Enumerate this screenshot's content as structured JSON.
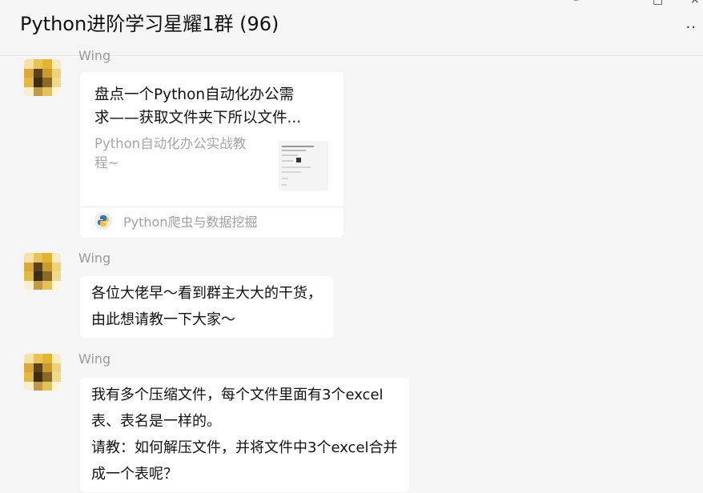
{
  "header": {
    "title": "Python进阶学习星耀1群 (96)",
    "minimize_glyph": "–",
    "maximize_glyph": "□",
    "close_glyph": "×",
    "more_glyph": "··"
  },
  "messages": [
    {
      "sender": "Wing",
      "type": "link-card",
      "card": {
        "title_lines": [
          "盘点一个Python自动化办公需",
          "求——获取文件夹下所以文件..."
        ],
        "desc_lines": [
          "Python自动化办公实战教",
          "程~"
        ],
        "thumbnail_icon": "article-thumbnail",
        "source": "Python爬虫与数据挖掘",
        "source_icon": "python-logo-icon"
      }
    },
    {
      "sender": "Wing",
      "type": "text",
      "lines": [
        "各位大佬早～看到群主大大的干货，",
        "由此想请教一下大家～"
      ]
    },
    {
      "sender": "Wing",
      "type": "text",
      "lines": [
        "我有多个压缩文件，每个文件里面有3个excel",
        "表、表名是一样的。",
        "请教：如何解压文件，并将文件中3个excel合并",
        "成一个表呢？"
      ]
    }
  ],
  "colors": {
    "background": "#f5f5f5",
    "bubble": "#ffffff",
    "sender_name": "#9a9a9a",
    "avatar_yellow": "#e6b422",
    "avatar_dark": "#3d2e12"
  }
}
